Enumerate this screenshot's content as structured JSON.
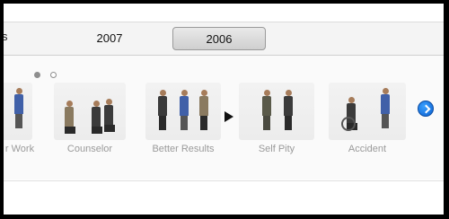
{
  "tabs": {
    "partial_left": "s",
    "items": [
      {
        "label": "2007",
        "selected": false
      },
      {
        "label": "2006",
        "selected": true
      }
    ]
  },
  "pager": {
    "pages": 2,
    "current": 1
  },
  "cards": [
    {
      "label": "r Work"
    },
    {
      "label": "Counselor"
    },
    {
      "label": "Better Results"
    },
    {
      "label": "Self Pity"
    },
    {
      "label": "Accident"
    }
  ],
  "icons": {
    "play": "play-icon",
    "next": "chevron-right-icon"
  },
  "colors": {
    "next_button": "#1a73e8",
    "label": "#9a9a9a"
  }
}
